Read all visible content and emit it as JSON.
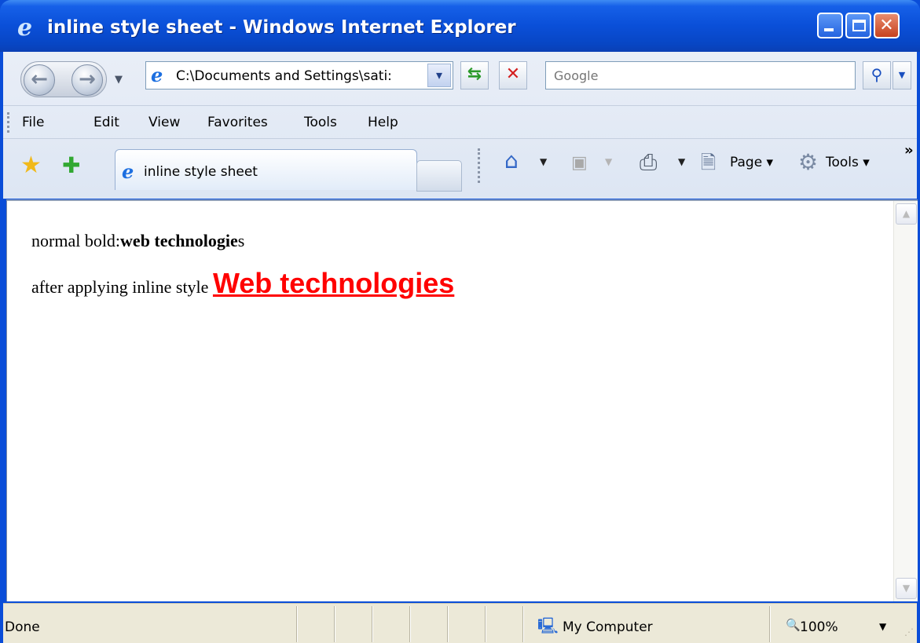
{
  "window": {
    "title": "inline style sheet - Windows Internet Explorer"
  },
  "address": {
    "url": "C:\\Documents and Settings\\sati:"
  },
  "search": {
    "placeholder": "Google"
  },
  "menu": {
    "file": "File",
    "edit": "Edit",
    "view": "View",
    "favorites": "Favorites",
    "tools": "Tools",
    "help": "Help"
  },
  "tab": {
    "label": "inline style sheet"
  },
  "commandbar": {
    "page_label": "Page",
    "tools_label": "Tools",
    "overflow": "»"
  },
  "content": {
    "line1_prefix": "normal bold:",
    "line1_bold": "web technologie",
    "line1_suffix": "s",
    "line2_prefix": "after applying inline style ",
    "line2_styled": "Web technologies",
    "styled_color": "#ff0000"
  },
  "status": {
    "text": "Done",
    "zone": "My Computer",
    "zoom": "100%"
  },
  "icons": {
    "ie_logo": "ie-logo-icon",
    "back": "back-arrow-icon",
    "forward": "forward-arrow-icon",
    "refresh": "refresh-icon",
    "stop": "stop-icon",
    "search": "magnifier-icon",
    "favorites": "star-icon",
    "add_favorites": "add-favorites-icon",
    "home": "home-icon",
    "feeds": "feeds-icon",
    "print": "printer-icon",
    "page": "page-icon",
    "tools": "gear-icon",
    "zone": "computer-icon",
    "zoom": "zoom-icon"
  }
}
